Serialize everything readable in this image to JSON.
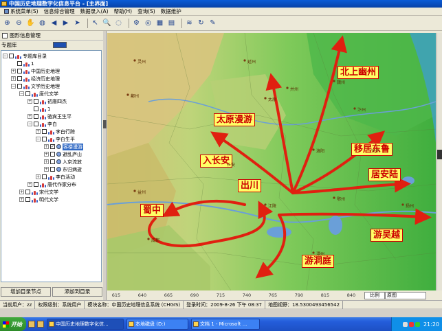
{
  "window": {
    "title": "中国历史地理数字化信息平台 - [主界面]"
  },
  "menu": [
    {
      "label": "系统菜单(S)",
      "icon": "system-menu-icon"
    },
    {
      "label": "信息综合管理"
    },
    {
      "label": "数据录入(A)"
    },
    {
      "label": "帮助(H)"
    },
    {
      "label": "查询(S)"
    },
    {
      "label": "数据维护"
    }
  ],
  "toolbar": {
    "items": [
      "zoom-in-icon",
      "zoom-out-icon",
      "pan-icon",
      "globe-icon",
      "back-arrow-icon",
      "forward-arrow-icon",
      "pointer-icon",
      "select-arrow-icon",
      "query-icon",
      "lasso-icon",
      "measure-icon",
      "target-icon",
      "grid-icon",
      "table-icon",
      "layers-icon",
      "refresh-icon",
      "edit-icon"
    ]
  },
  "left_panel": {
    "title": "图形信息管理",
    "library_label": "专题库",
    "tree": [
      {
        "level": 0,
        "expander": "−",
        "icon": "folder",
        "label": "专题库目录",
        "checked": false
      },
      {
        "level": 1,
        "expander": "",
        "icon": "node",
        "label": "1",
        "checked": false
      },
      {
        "level": 1,
        "expander": "+",
        "icon": "node",
        "label": "中国历史地理",
        "checked": false
      },
      {
        "level": 1,
        "expander": "+",
        "icon": "node",
        "label": "经济历史地理",
        "checked": false
      },
      {
        "level": 1,
        "expander": "−",
        "icon": "node",
        "label": "文学历史地理",
        "checked": false
      },
      {
        "level": 2,
        "expander": "−",
        "icon": "node",
        "label": "唐代文学",
        "checked": false
      },
      {
        "level": 3,
        "expander": "+",
        "icon": "node",
        "label": "初唐四杰",
        "checked": false
      },
      {
        "level": 3,
        "expander": "",
        "icon": "node",
        "label": "1",
        "checked": false
      },
      {
        "level": 3,
        "expander": "+",
        "icon": "node",
        "label": "骆宾王生平",
        "checked": false
      },
      {
        "level": 3,
        "expander": "−",
        "icon": "node",
        "label": "李白",
        "checked": false
      },
      {
        "level": 4,
        "expander": "+",
        "icon": "node",
        "label": "李白行踪",
        "checked": false
      },
      {
        "level": 4,
        "expander": "−",
        "icon": "node",
        "label": "李白生平",
        "checked": false
      },
      {
        "level": 5,
        "expander": "+",
        "icon": "leaf",
        "label": "客楼漫游",
        "checked": true,
        "selected": true
      },
      {
        "level": 5,
        "expander": "+",
        "icon": "leaf",
        "label": "避乱庐山",
        "checked": false
      },
      {
        "level": 5,
        "expander": "+",
        "icon": "leaf",
        "label": "入京流放",
        "checked": false
      },
      {
        "level": 5,
        "expander": "+",
        "icon": "leaf",
        "label": "东归病逝",
        "checked": false
      },
      {
        "level": 4,
        "expander": "+",
        "icon": "node",
        "label": "李白活动",
        "checked": false
      },
      {
        "level": 3,
        "expander": "+",
        "icon": "node",
        "label": "唐代作家分布",
        "checked": false
      },
      {
        "level": 2,
        "expander": "+",
        "icon": "node",
        "label": "宋代文学",
        "checked": false
      },
      {
        "level": 2,
        "expander": "+",
        "icon": "node",
        "label": "明代文学",
        "checked": false
      }
    ],
    "buttons": {
      "add_child": "增加目录节点",
      "add_root": "添加到目录"
    }
  },
  "map": {
    "labels": {
      "north": "北上幽州",
      "taiyuan": "太原漫游",
      "changan": "入长安",
      "chuchuan": "出川",
      "shuzhong": "蜀中",
      "liju": "移居东鲁",
      "anlu": "居安陆",
      "wuyue": "游吴越",
      "dongting": "游洞庭"
    },
    "places": [
      "灵州",
      "鄯州",
      "延州",
      "太原",
      "并州",
      "长安",
      "洛阳",
      "汴州",
      "益州",
      "成都",
      "扬州",
      "鄂州",
      "江陵",
      "潭州",
      "宋州",
      "魏州"
    ],
    "ruler": [
      "615",
      "640",
      "665",
      "690",
      "715",
      "740",
      "765",
      "790",
      "815",
      "840"
    ],
    "scale_label": "比例",
    "scale_value": "原图"
  },
  "status": {
    "user": "当前用户：zz",
    "role": "权限级别：系统用户",
    "module": "模块名称：中国历史地理信息系统 (CHGIS)",
    "login": "登录时间：2009-8-26 下午 08:37",
    "scale": "地图视野：18.5300493456542"
  },
  "taskbar": {
    "start": "开始",
    "tasks": [
      "中国历史地理数字化信...",
      "本地磁盘 (D:)",
      "文档 1 - Microsoft ..."
    ],
    "clock": "21:20"
  },
  "colors": {
    "label_fill": "#ffff66",
    "label_text": "#cc0000",
    "arrow": "#e02010",
    "titlebar": "#0a5bd7"
  }
}
